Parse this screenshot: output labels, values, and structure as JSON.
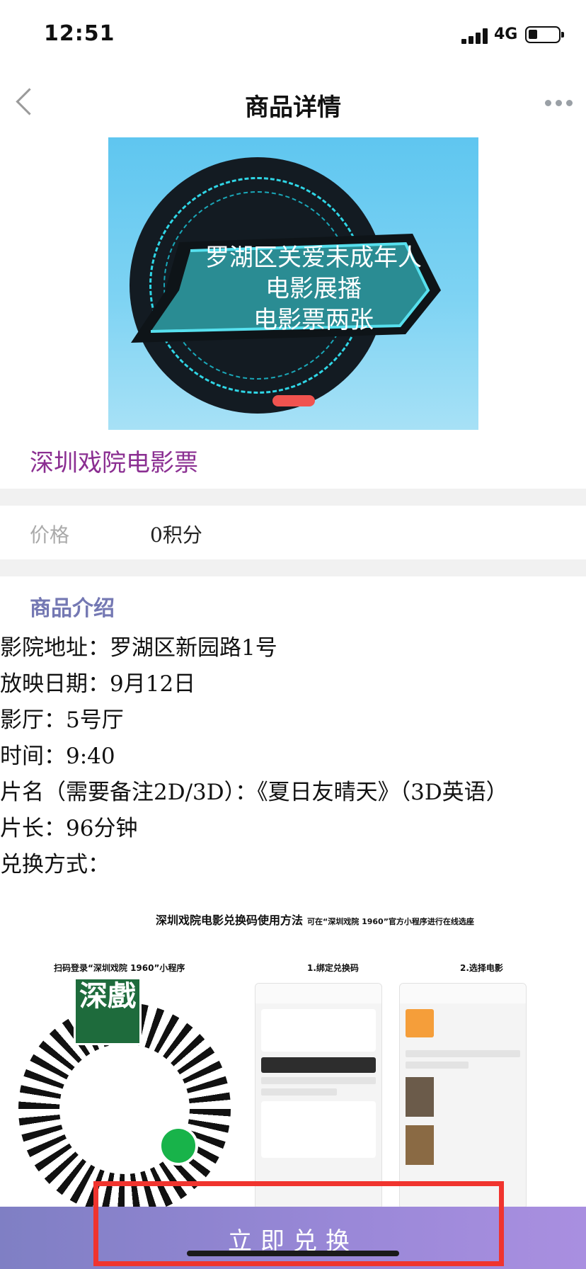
{
  "status_bar": {
    "time": "12:51",
    "network": "4G"
  },
  "nav": {
    "title": "商品详情"
  },
  "hero": {
    "lines": [
      "罗湖区关爱未成年人",
      "电影展播",
      "电影票两张"
    ]
  },
  "product": {
    "title": "深圳戏院电影票"
  },
  "price": {
    "label": "价格",
    "value": "0积分"
  },
  "intro": {
    "title": "商品介绍",
    "lines": [
      "影院地址：罗湖区新园路1号",
      "放映日期：9月12日",
      "影厅：5号厅",
      "时间：9:40",
      "片名（需要备注2D/3D）：《夏日友晴天》（3D英语）",
      "片长：96分钟",
      "兑换方式："
    ]
  },
  "guide": {
    "heading": "深圳戏院电影兑换码使用方法",
    "heading_note": "可在“深圳戏院 1960”官方小程序进行在线选座",
    "step0": "扫码登录“深圳戏院 1960”小程序",
    "step1": "1.绑定兑换码",
    "step2": "2.选择电影",
    "qr_logo": "深戲"
  },
  "action": {
    "redeem_label": "立即兑换"
  },
  "colors": {
    "accent": "#8b2f92",
    "intro_title": "#7478b3",
    "bar_start": "#7f7fc4",
    "bar_end": "#a98fe0",
    "highlight": "#f0342e"
  }
}
